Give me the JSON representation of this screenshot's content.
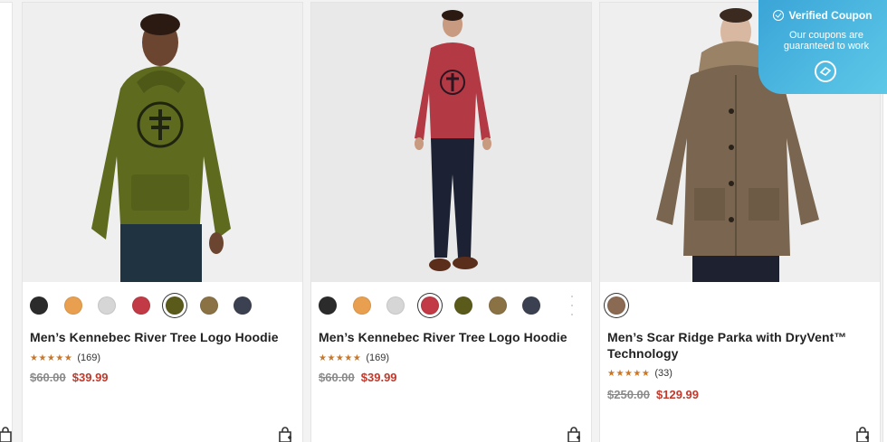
{
  "products": [
    {
      "name": "Men’s Kennebec River Tree Logo Hoodie",
      "review_count": "(169)",
      "stars": "★★★★★",
      "original_price": "$60.00",
      "sale_price": "$39.99",
      "swatches": [
        "#2b2b2b",
        "#e8a050",
        "#d6d6d6",
        "#c13a45",
        "#5a5a1a",
        "#8a7245",
        "#3b4150"
      ],
      "selected_swatch": 4,
      "photo_colors": {
        "garment": "#5e6a1e",
        "pants": "#1f3340",
        "skin": "#6b4530"
      }
    },
    {
      "name": "Men’s Kennebec River Tree Logo Hoodie",
      "review_count": "(169)",
      "stars": "★★★★★",
      "original_price": "$60.00",
      "sale_price": "$39.99",
      "swatches": [
        "#2b2b2b",
        "#e8a050",
        "#d6d6d6",
        "#c13a45",
        "#5a5a1a",
        "#8a7245",
        "#3b4150"
      ],
      "selected_swatch": 3,
      "photo_colors": {
        "garment": "#b33a45",
        "pants": "#1c2233",
        "skin": "#c89a80"
      }
    },
    {
      "name": "Men’s Scar Ridge Parka with DryVent™ Technology",
      "review_count": "(33)",
      "stars": "★★★★★",
      "original_price": "$250.00",
      "sale_price": "$129.99",
      "swatches": [
        "#8a6a52"
      ],
      "selected_swatch": 0,
      "photo_colors": {
        "garment": "#7a6650",
        "pants": "#1e2230",
        "skin": "#d8b8a0"
      }
    }
  ],
  "coupon": {
    "title": "Verified Coupon",
    "subtitle": "Our coupons are guaranteed to work",
    "accent": "#3aa5d7"
  },
  "icons": {
    "bag": "shopping-bag-icon",
    "check": "check-circle-icon",
    "logo": "coupon-logo-icon"
  }
}
